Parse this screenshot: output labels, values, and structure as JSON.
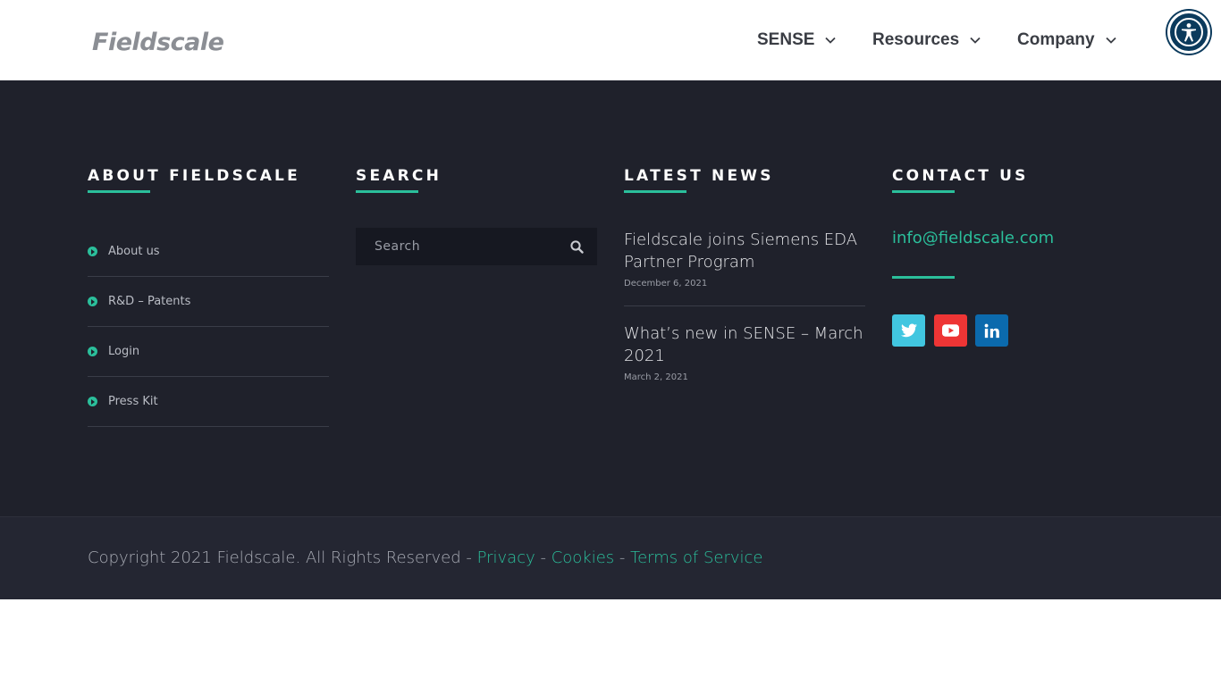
{
  "header": {
    "logo_text": "Fieldscale",
    "nav": [
      {
        "label": "SENSE"
      },
      {
        "label": "Resources"
      },
      {
        "label": "Company"
      }
    ]
  },
  "about": {
    "title": "ABOUT FIELDSCALE",
    "links": [
      "About us",
      "R&D – Patents",
      "Login",
      "Press Kit"
    ]
  },
  "search": {
    "title": "SEARCH",
    "placeholder": "Search"
  },
  "news": {
    "title": "LATEST NEWS",
    "items": [
      {
        "title": "Fieldscale joins Siemens EDA Partner Program",
        "date": "December 6, 2021"
      },
      {
        "title": "What’s new in SENSE – March 2021",
        "date": "March 2, 2021"
      }
    ]
  },
  "contact": {
    "title": "CONTACT US",
    "email": "info@fieldscale.com",
    "socials": [
      {
        "name": "twitter",
        "color": "#41c6e0"
      },
      {
        "name": "youtube",
        "color": "#ee3535"
      },
      {
        "name": "linkedin",
        "color": "#0b6aad"
      }
    ]
  },
  "copyright": {
    "text": "Copyright 2021 Fieldscale. All Rights Reserved - ",
    "privacy": "Privacy",
    "sep1": " - ",
    "cookies": "Cookies",
    "sep2": " - ",
    "terms": "Terms of Service"
  },
  "colors": {
    "accent": "#2bbf9b",
    "footer_bg": "#1f212b",
    "copyright_bg": "#242632"
  }
}
